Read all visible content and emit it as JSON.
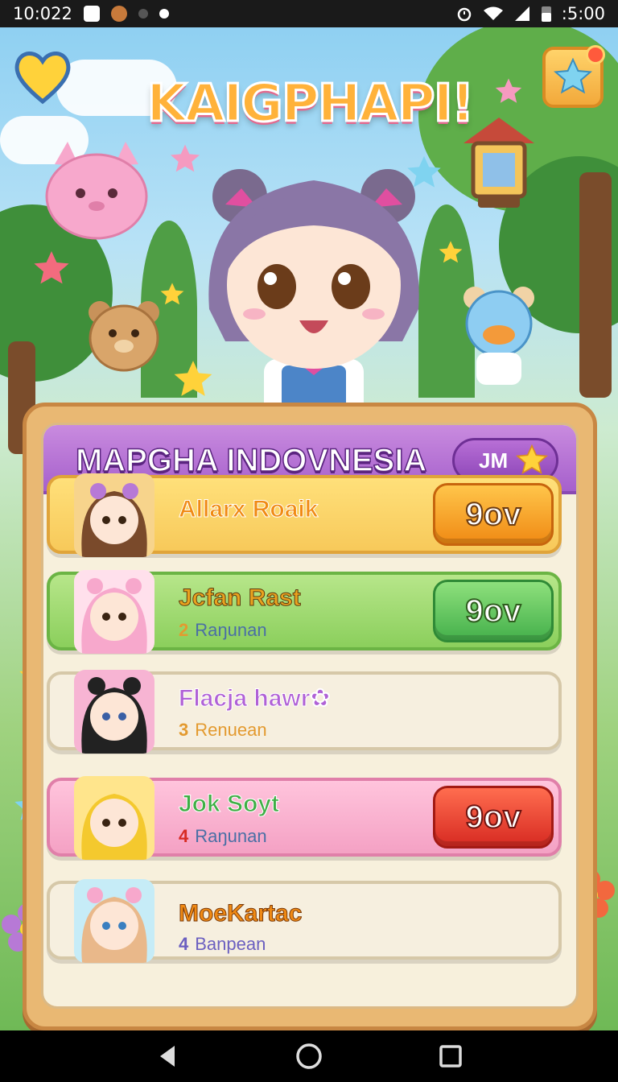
{
  "status_bar": {
    "time": "10:022",
    "right_time": ":5:00"
  },
  "game": {
    "title": "KAIGPHAPI!",
    "leaderboard": {
      "title": "MAPGHA INDOVNESIA",
      "badge_label": "JM",
      "rows": [
        {
          "name": "Allarx Roaik",
          "rank_number": "",
          "rank_text": "",
          "score": "9ov",
          "name_color": "#f08a14"
        },
        {
          "name": "Jcfan Rast",
          "rank_number": "2",
          "rank_text": "Raŋunan",
          "score": "9ov",
          "name_color": "#e9a21f"
        },
        {
          "name": "Flacja hawr✿",
          "rank_number": "3",
          "rank_text": "Renuean",
          "score": "",
          "name_color": "#b061d6"
        },
        {
          "name": "Jok Soyt",
          "rank_number": "4",
          "rank_text": "Raŋunan",
          "score": "9ov",
          "name_color": "#3fae45"
        },
        {
          "name": "MoeKartac",
          "rank_number": "4",
          "rank_text": "Banpean",
          "score": "",
          "name_color": "#f08a14"
        }
      ]
    }
  },
  "icons": {
    "heart": "heart-icon",
    "gift": "star-gift-icon",
    "badge": "star-icon",
    "back": "back-icon",
    "home": "home-icon",
    "recents": "recents-icon"
  },
  "colors": {
    "panel_header": "#a660cc",
    "panel_frame": "#e9b873",
    "orange_button": "#f08a14",
    "green_button": "#44b04b",
    "red_button": "#d72a22"
  }
}
